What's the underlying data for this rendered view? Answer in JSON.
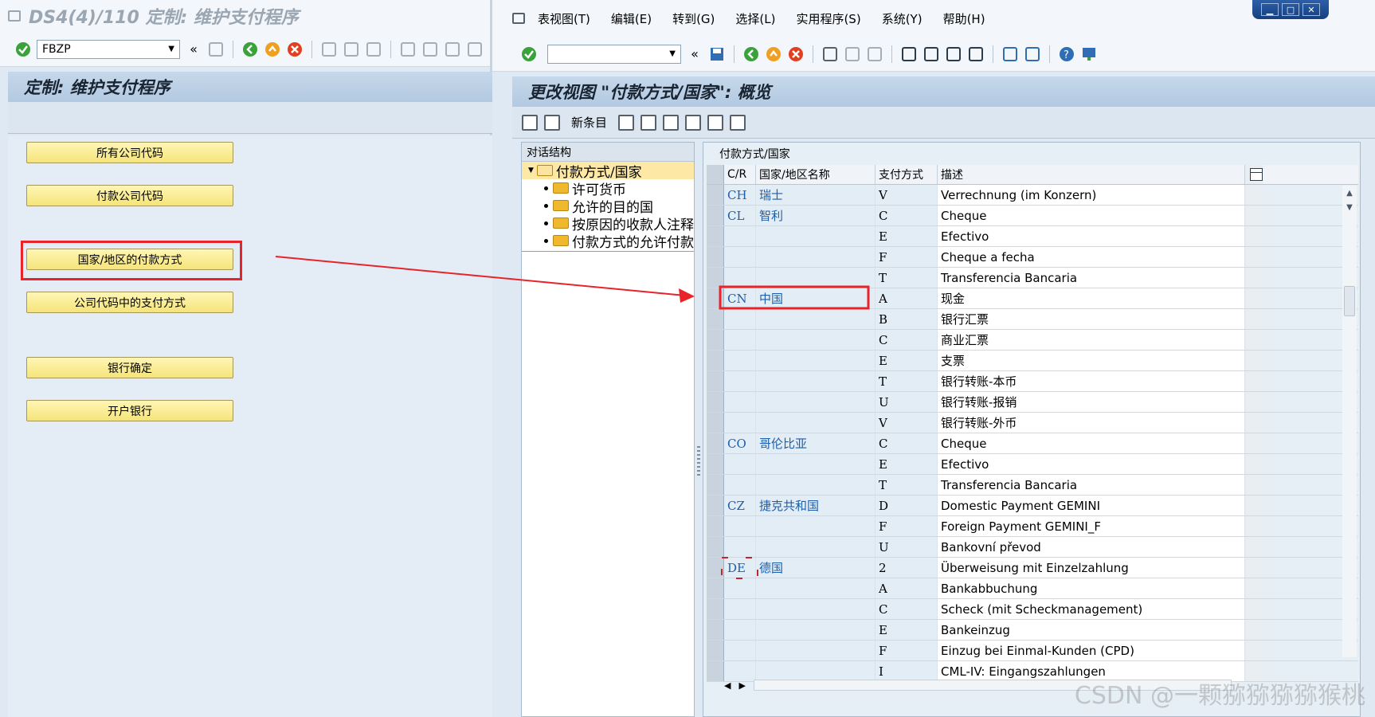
{
  "left": {
    "window_title": "DS4(4)/110 定制: 维护支付程序",
    "command_field": "FBZP",
    "screen_title": "定制: 维护支付程序",
    "buttons": [
      {
        "label": "所有公司代码"
      },
      {
        "label": "付款公司代码"
      },
      {
        "label": "国家/地区的付款方式"
      },
      {
        "label": "公司代码中的支付方式"
      },
      {
        "label": "银行确定"
      },
      {
        "label": "开户银行"
      }
    ]
  },
  "right": {
    "menu": [
      "表视图(T)",
      "编辑(E)",
      "转到(G)",
      "选择(L)",
      "实用程序(S)",
      "系统(Y)",
      "帮助(H)"
    ],
    "command_field": "",
    "screen_title": "更改视图 \"付款方式/国家\": 概览",
    "new_entries_label": "新条目",
    "tree": {
      "header": "对话结构",
      "root": "付款方式/国家",
      "children": [
        "许可货币",
        "允许的目的国",
        "按原因的收款人注释",
        "付款方式的允许付款"
      ]
    },
    "table": {
      "caption": "付款方式/国家",
      "headers": {
        "cr": "C/R",
        "name": "国家/地区名称",
        "pm": "支付方式",
        "desc": "描述"
      },
      "rows": [
        {
          "cr": "CH",
          "name": "瑞士",
          "pm": "V",
          "desc": "Verrechnung (im Konzern)"
        },
        {
          "cr": "CL",
          "name": "智利",
          "pm": "C",
          "desc": "Cheque"
        },
        {
          "cr": "",
          "name": "",
          "pm": "E",
          "desc": "Efectivo"
        },
        {
          "cr": "",
          "name": "",
          "pm": "F",
          "desc": "Cheque a fecha"
        },
        {
          "cr": "",
          "name": "",
          "pm": "T",
          "desc": "Transferencia Bancaria"
        },
        {
          "cr": "CN",
          "name": "中国",
          "pm": "A",
          "desc": "现金"
        },
        {
          "cr": "",
          "name": "",
          "pm": "B",
          "desc": "银行汇票"
        },
        {
          "cr": "",
          "name": "",
          "pm": "C",
          "desc": "商业汇票"
        },
        {
          "cr": "",
          "name": "",
          "pm": "E",
          "desc": "支票"
        },
        {
          "cr": "",
          "name": "",
          "pm": "T",
          "desc": "银行转账-本币"
        },
        {
          "cr": "",
          "name": "",
          "pm": "U",
          "desc": "银行转账-报销"
        },
        {
          "cr": "",
          "name": "",
          "pm": "V",
          "desc": "银行转账-外币"
        },
        {
          "cr": "CO",
          "name": "哥伦比亚",
          "pm": "C",
          "desc": "Cheque"
        },
        {
          "cr": "",
          "name": "",
          "pm": "E",
          "desc": "Efectivo"
        },
        {
          "cr": "",
          "name": "",
          "pm": "T",
          "desc": "Transferencia Bancaria"
        },
        {
          "cr": "CZ",
          "name": "捷克共和国",
          "pm": "D",
          "desc": "Domestic Payment GEMINI"
        },
        {
          "cr": "",
          "name": "",
          "pm": "F",
          "desc": "Foreign Payment GEMINI_F"
        },
        {
          "cr": "",
          "name": "",
          "pm": "U",
          "desc": "Bankovní převod"
        },
        {
          "cr": "DE",
          "name": "德国",
          "pm": "2",
          "desc": "Überweisung mit Einzelzahlung"
        },
        {
          "cr": "",
          "name": "",
          "pm": "A",
          "desc": "Bankabbuchung"
        },
        {
          "cr": "",
          "name": "",
          "pm": "C",
          "desc": "Scheck (mit Scheckmanagement)"
        },
        {
          "cr": "",
          "name": "",
          "pm": "E",
          "desc": "Bankeinzug"
        },
        {
          "cr": "",
          "name": "",
          "pm": "F",
          "desc": "Einzug bei Einmal-Kunden (CPD)"
        },
        {
          "cr": "",
          "name": "",
          "pm": "I",
          "desc": "CML-IV: Eingangszahlungen"
        }
      ]
    }
  },
  "watermark": "CSDN @一颗猕猕猕猕猴桃",
  "colors": {
    "highlight": "#e8232a",
    "button": "#f5e47a",
    "link": "#1e5fa8"
  }
}
